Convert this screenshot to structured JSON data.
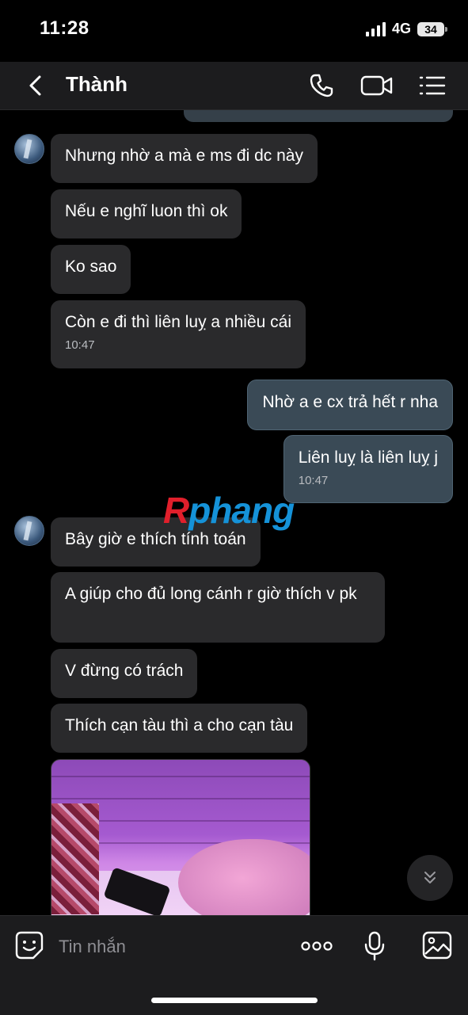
{
  "status_bar": {
    "time": "11:28",
    "network": "4G",
    "battery": "34"
  },
  "header": {
    "contact_name": "Thành"
  },
  "messages": [
    {
      "text": "Nhưng nhờ a mà e ms đi dc này"
    },
    {
      "text": "Nếu e nghĩ luon thì ok"
    },
    {
      "text": "Ko sao"
    },
    {
      "text": "Còn e đi thì liên luỵ a nhiều cái",
      "time": "10:47"
    },
    {
      "text": "Nhờ a e cx trả hết r nha"
    },
    {
      "text": "Liên luỵ là liên luỵ j",
      "time": "10:47"
    },
    {
      "text": "Bây giờ e thích tính toán"
    },
    {
      "text": "A giúp cho đủ long cánh r giờ thích v pk"
    },
    {
      "text": "V đừng có trách"
    },
    {
      "text": "Thích cạn tàu thì a cho cạn tàu"
    }
  ],
  "watermark": {
    "part1": "R",
    "part2": "phang"
  },
  "composer": {
    "placeholder": "Tin nhắn"
  }
}
